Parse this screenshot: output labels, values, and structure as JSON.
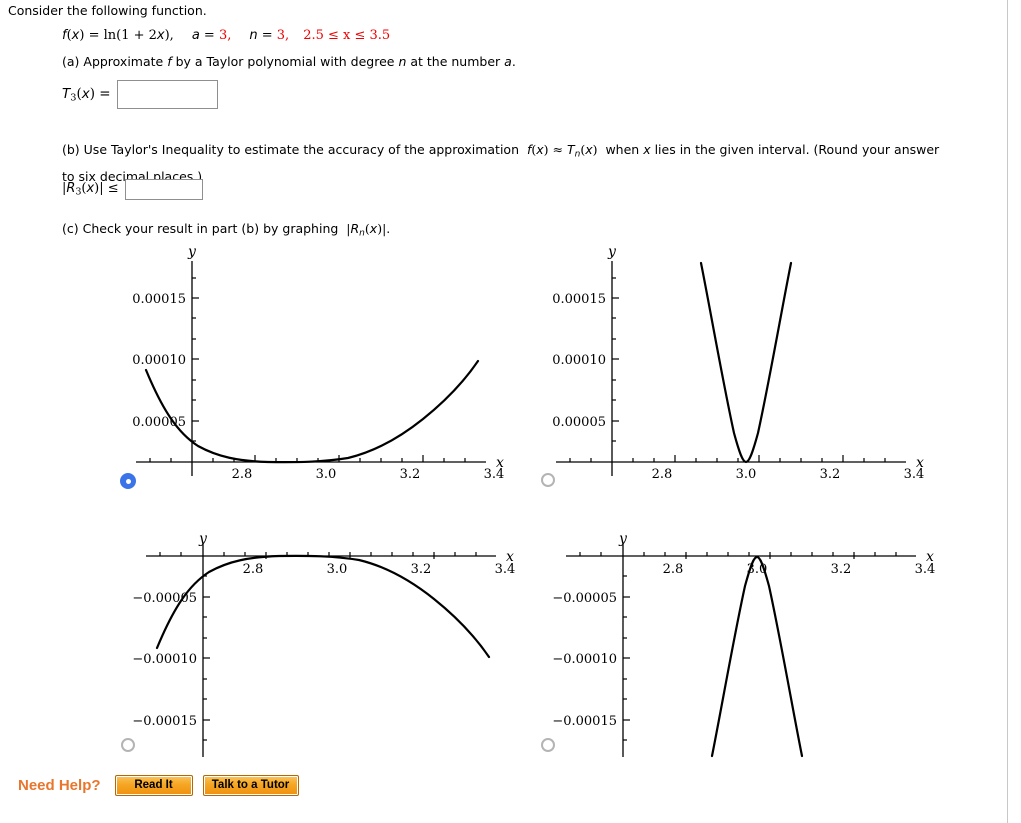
{
  "problem": {
    "intro": "Consider the following function.",
    "function_expr": "f(x) = ln(1 + 2x),",
    "a_label": "a = ",
    "a_value": "3,",
    "n_label": "n = ",
    "n_value": "3,",
    "interval": "2.5 ≤ x ≤ 3.5",
    "accent_red": "#ee0000"
  },
  "part_a": {
    "text_before": "(a) Approximate ",
    "f_italic": "f",
    "text_mid": " by a Taylor polynomial with degree ",
    "n_italic": "n",
    "text_after": " at the number ",
    "a_italic": "a",
    "period": ".",
    "answer_label": "T3(x) =",
    "answer_value": "",
    "answer_placeholder": ""
  },
  "part_b": {
    "line1_a": "(b) Use Taylor's Inequality to estimate the accuracy of the approximation  ",
    "line1_approx": "f(x) ≈ Tn(x)",
    "line1_b": "  when ",
    "line1_x": "x",
    "line1_c": " lies in the given interval. (Round your answer",
    "line2": "to six decimal places.)",
    "answer_label": "|R3(x)| ≤",
    "answer_value": "",
    "answer_placeholder": ""
  },
  "part_c": {
    "text_before": "(c) Check your result in part (b) by graphing  ",
    "expr": "|Rn(x)|",
    "text_after": "."
  },
  "graphs": [
    {
      "id": "graph-a",
      "selected": true,
      "axis_x_label": "x",
      "axis_y_label": "y",
      "x_ticks": [
        "2.8",
        "3.0",
        "3.2",
        "3.4"
      ],
      "y_ticks": [
        "0.00015",
        "0.00010",
        "0.00005"
      ]
    },
    {
      "id": "graph-b",
      "selected": false,
      "axis_x_label": "x",
      "axis_y_label": "y",
      "x_ticks": [
        "2.8",
        "3.0",
        "3.2",
        "3.4"
      ],
      "y_ticks": [
        "0.00015",
        "0.00010",
        "0.00005"
      ]
    },
    {
      "id": "graph-c",
      "selected": false,
      "axis_x_label": "x",
      "axis_y_label": "y",
      "x_ticks": [
        "2.8",
        "3.0",
        "3.2",
        "3.4"
      ],
      "y_ticks": [
        "−0.00005",
        "−0.00010",
        "−0.00015"
      ]
    },
    {
      "id": "graph-d",
      "selected": false,
      "axis_x_label": "x",
      "axis_y_label": "y",
      "x_ticks": [
        "2.8",
        "3.0",
        "3.2",
        "3.4"
      ],
      "y_ticks": [
        "−0.00005",
        "−0.00010",
        "−0.00015"
      ]
    }
  ],
  "chart_data": [
    {
      "type": "line",
      "title": "",
      "xlabel": "x",
      "ylabel": "y",
      "xlim": [
        2.62,
        3.52
      ],
      "ylim": [
        0.0,
        0.000178
      ],
      "xticks": [
        2.8,
        3.0,
        3.2,
        3.4
      ],
      "yticks": [
        5e-05,
        0.0001,
        0.00015
      ],
      "grid": false,
      "legend": null,
      "series": [
        {
          "name": "|R3(x)| flat-bottom",
          "x": [
            2.62,
            2.66,
            2.7,
            2.75,
            2.8,
            2.85,
            2.9,
            2.95,
            3.0,
            3.05,
            3.1,
            3.15,
            3.2,
            3.25,
            3.3,
            3.35,
            3.4,
            3.45,
            3.5
          ],
          "y": [
            0.000118,
            9.05e-05,
            6.65e-05,
            4.15e-05,
            2.35e-05,
            1.15e-05,
            4.5e-06,
            1e-06,
            0.0,
            8e-07,
            3.2e-06,
            8.5e-06,
            1.65e-05,
            2.8e-05,
            4.2e-05,
            5.8e-05,
            7.3e-05,
            8.5e-05,
            9.45e-05
          ]
        }
      ]
    },
    {
      "type": "line",
      "title": "",
      "xlabel": "x",
      "ylabel": "y",
      "xlim": [
        2.62,
        3.52
      ],
      "ylim": [
        0.0,
        0.000178
      ],
      "xticks": [
        2.8,
        3.0,
        3.2,
        3.4
      ],
      "yticks": [
        5e-05,
        0.0001,
        0.00015
      ],
      "grid": false,
      "legend": null,
      "series": [
        {
          "name": "narrow upward parabola at 3.0",
          "x": [
            2.855,
            2.88,
            2.9,
            2.92,
            2.94,
            2.96,
            2.98,
            3.0,
            3.02,
            3.04,
            3.06,
            3.08,
            3.1,
            3.12,
            3.14,
            3.165
          ],
          "y": [
            0.000178,
            0.000126,
            9e-05,
            5.76e-05,
            3.24e-05,
            1.44e-05,
            3.6e-06,
            0.0,
            3.6e-06,
            1.44e-05,
            3.24e-05,
            5.76e-05,
            9e-05,
            0.000126,
            0.000157,
            0.000178
          ]
        }
      ]
    },
    {
      "type": "line",
      "title": "",
      "xlabel": "x",
      "ylabel": "y",
      "xlim": [
        2.62,
        3.52
      ],
      "ylim": [
        -0.000178,
        0.0
      ],
      "xticks": [
        2.8,
        3.0,
        3.2,
        3.4
      ],
      "yticks": [
        -5e-05,
        -0.0001,
        -0.00015
      ],
      "grid": false,
      "legend": null,
      "series": [
        {
          "name": "flat-top negative curve",
          "x": [
            2.62,
            2.66,
            2.7,
            2.75,
            2.8,
            2.85,
            2.9,
            2.95,
            3.0,
            3.05,
            3.1,
            3.15,
            3.2,
            3.25,
            3.3,
            3.35,
            3.4,
            3.45,
            3.5
          ],
          "y": [
            -0.000118,
            -9.05e-05,
            -6.65e-05,
            -4.15e-05,
            -2.35e-05,
            -1.15e-05,
            -4.5e-06,
            -1e-06,
            0.0,
            -8e-07,
            -3.2e-06,
            -8.5e-06,
            -1.65e-05,
            -2.8e-05,
            -4.2e-05,
            -5.8e-05,
            -7.3e-05,
            -8.5e-05,
            -9.45e-05
          ]
        }
      ]
    },
    {
      "type": "line",
      "title": "",
      "xlabel": "x",
      "ylabel": "y",
      "xlim": [
        2.62,
        3.52
      ],
      "ylim": [
        -0.000178,
        0.0
      ],
      "xticks": [
        2.8,
        3.0,
        3.2,
        3.4
      ],
      "yticks": [
        -5e-05,
        -0.0001,
        -0.00015
      ],
      "grid": false,
      "legend": null,
      "series": [
        {
          "name": "narrow downward parabola at 3.0",
          "x": [
            2.855,
            2.88,
            2.9,
            2.92,
            2.94,
            2.96,
            2.98,
            3.0,
            3.02,
            3.04,
            3.06,
            3.08,
            3.1,
            3.12,
            3.14,
            3.165
          ],
          "y": [
            -0.000178,
            -0.000126,
            -9e-05,
            -5.76e-05,
            -3.24e-05,
            -1.44e-05,
            -3.6e-06,
            0.0,
            -3.6e-06,
            -1.44e-05,
            -3.24e-05,
            -5.76e-05,
            -9e-05,
            -0.000126,
            -0.000157,
            -0.000178
          ]
        }
      ]
    }
  ],
  "need_help": {
    "label": "Need Help?",
    "read_it": "Read It",
    "talk_tutor": "Talk to a Tutor",
    "accent": "#e8762c"
  }
}
